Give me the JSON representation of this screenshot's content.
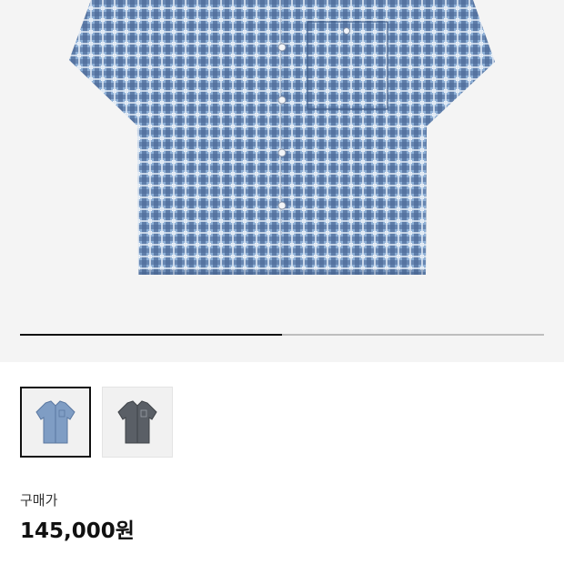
{
  "product": {
    "gallery": {
      "progress": 0.5,
      "thumbnails": [
        {
          "name": "blue-check-shirt",
          "color": "#7f9dc4",
          "selected": true
        },
        {
          "name": "grey-check-shirt",
          "color": "#5a5f66",
          "selected": false
        }
      ]
    },
    "price_label": "구매가",
    "price": "145,000원"
  },
  "colors": {
    "shirt_blue": "#7d9ac3",
    "shirt_dark": "#51647f",
    "shirt_grey": "#5a5f66",
    "background": "#f4f4f4"
  }
}
